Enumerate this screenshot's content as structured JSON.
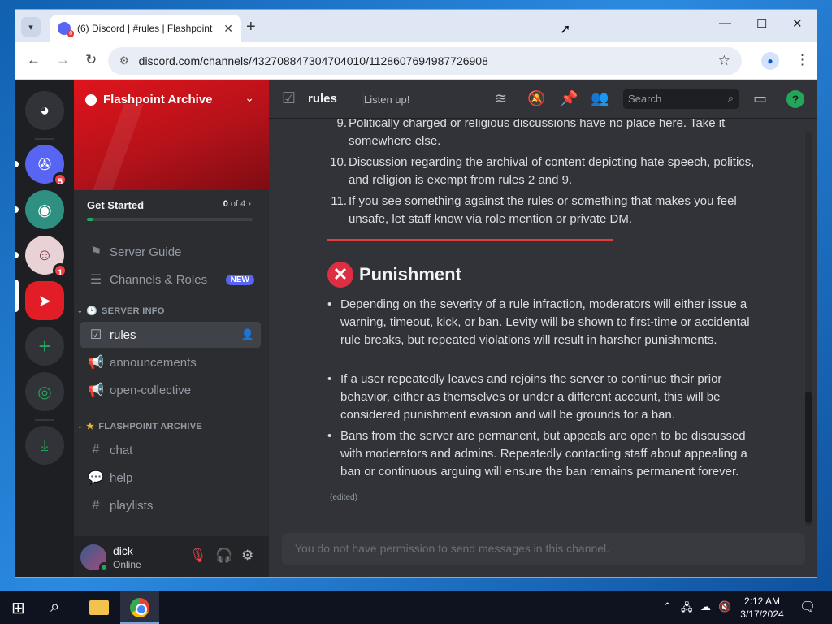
{
  "browser": {
    "tab_title": "(6) Discord | #rules | Flashpoint",
    "favicon_badge": "6",
    "url": "discord.com/channels/432708847304704010/1128607694987726908"
  },
  "guilds": {
    "badge_1": "5",
    "badge_3": "1"
  },
  "server": {
    "name": "Flashpoint Archive",
    "get_started_label": "Get Started",
    "progress_done": "0",
    "progress_of": "of",
    "progress_total": "4",
    "progress_fraction": 0.04,
    "server_guide": "Server Guide",
    "channels_roles": "Channels & Roles",
    "new_badge": "NEW",
    "cat_server_info": "SERVER INFO",
    "cat_flashpoint": "FLASHPOINT ARCHIVE",
    "channels": {
      "rules": "rules",
      "announcements": "announcements",
      "open_collective": "open-collective",
      "chat": "chat",
      "help": "help",
      "playlists": "playlists"
    }
  },
  "user": {
    "name": "dick",
    "status": "Online"
  },
  "header": {
    "channel": "rules",
    "topic": "Listen up!",
    "search_placeholder": "Search"
  },
  "rules_list": [
    {
      "num": "9.",
      "text": "Politically charged or religious discussions have no place here. Take it somewhere else."
    },
    {
      "num": "10.",
      "text": "Discussion regarding the archival of content depicting hate speech, politics, and religion is exempt from rules 2 and 9."
    },
    {
      "num": "11.",
      "text": "If you see something against the rules or something that makes you feel unsafe, let staff know via role mention or private DM."
    }
  ],
  "punishment": {
    "title": "Punishment",
    "bullets": [
      "Depending on the severity of a rule infraction, moderators will either issue a warning, timeout, kick, or ban. Levity will be shown to first-time or accidental rule breaks, but repeated violations will result in harsher punishments.",
      "If a user repeatedly leaves and rejoins the server to continue their prior behavior, either as themselves or under a different account, this will be considered punishment evasion and will be grounds for a ban.",
      "Bans from the server are permanent, but appeals are open to be discussed with moderators and admins. Repeatedly contacting staff about appealing a ban or continuous arguing will ensure the ban remains permanent forever."
    ],
    "edited": "(edited)"
  },
  "composer": {
    "text": "You do not have permission to send messages in this channel."
  },
  "taskbar": {
    "time": "2:12 AM",
    "date": "3/17/2024"
  },
  "colors": {
    "discord_bg": "#313338",
    "accent_red": "#e23c3c",
    "online_green": "#23a55a",
    "blurple": "#5865f2"
  }
}
